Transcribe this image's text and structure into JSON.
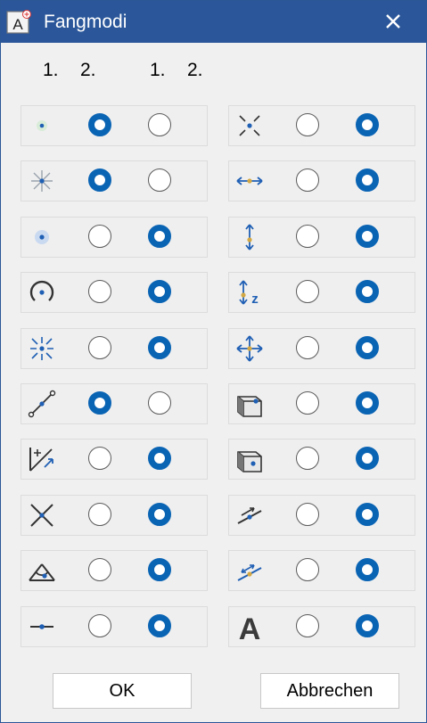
{
  "window": {
    "title": "Fangmodi",
    "app_icon": "snap-dialog-app-icon",
    "close_icon": "close-icon",
    "title_bar_color": "#2b579a"
  },
  "column_headers": {
    "left_first": "1.",
    "left_second": "2.",
    "right_first": "1.",
    "right_second": "2."
  },
  "accent_color": "#0a64b4",
  "snap_modes_left": [
    {
      "icon": "snap-point-icon",
      "first_selected": true,
      "second_selected": false
    },
    {
      "icon": "snap-star-point-icon",
      "first_selected": true,
      "second_selected": false
    },
    {
      "icon": "snap-area-point-icon",
      "first_selected": false,
      "second_selected": true
    },
    {
      "icon": "snap-circle-center-icon",
      "first_selected": false,
      "second_selected": true
    },
    {
      "icon": "snap-center-arrows-icon",
      "first_selected": false,
      "second_selected": true
    },
    {
      "icon": "snap-line-midpoint-icon",
      "first_selected": true,
      "second_selected": false
    },
    {
      "icon": "snap-relative-point-icon",
      "first_selected": false,
      "second_selected": true
    },
    {
      "icon": "snap-intersection-icon",
      "first_selected": false,
      "second_selected": true
    },
    {
      "icon": "snap-view-point-icon",
      "first_selected": false,
      "second_selected": true
    },
    {
      "icon": "snap-line-point-icon",
      "first_selected": false,
      "second_selected": true
    }
  ],
  "snap_modes_right": [
    {
      "icon": "snap-cross-point-icon",
      "first_selected": false,
      "second_selected": true
    },
    {
      "icon": "snap-horizontal-icon",
      "first_selected": false,
      "second_selected": true
    },
    {
      "icon": "snap-vertical-icon",
      "first_selected": false,
      "second_selected": true
    },
    {
      "icon": "snap-z-direction-icon",
      "first_selected": false,
      "second_selected": true
    },
    {
      "icon": "snap-all-directions-icon",
      "first_selected": false,
      "second_selected": true
    },
    {
      "icon": "snap-cube-edge-icon",
      "first_selected": false,
      "second_selected": true
    },
    {
      "icon": "snap-cube-face-icon",
      "first_selected": false,
      "second_selected": true
    },
    {
      "icon": "snap-parallel-icon",
      "first_selected": false,
      "second_selected": true
    },
    {
      "icon": "snap-perpendicular-icon",
      "first_selected": false,
      "second_selected": true
    },
    {
      "icon": "snap-text-icon",
      "first_selected": false,
      "second_selected": true
    }
  ],
  "buttons": {
    "ok": "OK",
    "cancel": "Abbrechen"
  }
}
